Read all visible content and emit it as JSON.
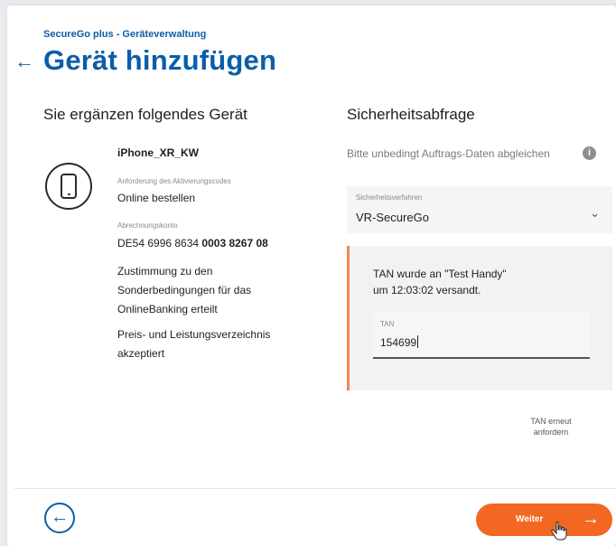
{
  "header": {
    "breadcrumb": "SecureGo plus - Geräteverwaltung",
    "back_icon": "arrow-left-icon",
    "title": "Gerät hinzufügen"
  },
  "left": {
    "heading": "Sie ergänzen folgendes Gerät",
    "device_icon": "smartphone-icon",
    "device_name": "iPhone_XR_KW",
    "activation_label": "Anforderung des Aktivierungscodes",
    "activation_value": "Online bestellen",
    "account_label": "Abrechnungskonto",
    "account_prefix": "DE54 6996 8634 ",
    "account_bold": "0003 8267 08",
    "consent": "Zustimmung zu den Sonderbedingungen für das OnlineBanking erteilt",
    "pricing": "Preis- und Leistungsverzeichnis akzeptiert"
  },
  "right": {
    "heading": "Sicherheitsabfrage",
    "hint": "Bitte unbedingt Auftrags-Daten abgleichen",
    "info_icon": "info-icon",
    "select_label": "Sicherheitsverfahren",
    "select_value": "VR-SecureGo",
    "tan_message": "TAN wurde an \"Test Handy\"\num 12:03:02 versandt.",
    "tan_label": "TAN",
    "tan_value": "154699",
    "resend": "TAN erneut anfordern"
  },
  "footer": {
    "back_icon": "arrow-left-circle-icon",
    "next_label": "Weiter",
    "next_icon": "arrow-right-icon"
  },
  "colors": {
    "brand_blue": "#0b5ea8",
    "accent_orange": "#f26722",
    "panel_border": "#f08a50"
  }
}
